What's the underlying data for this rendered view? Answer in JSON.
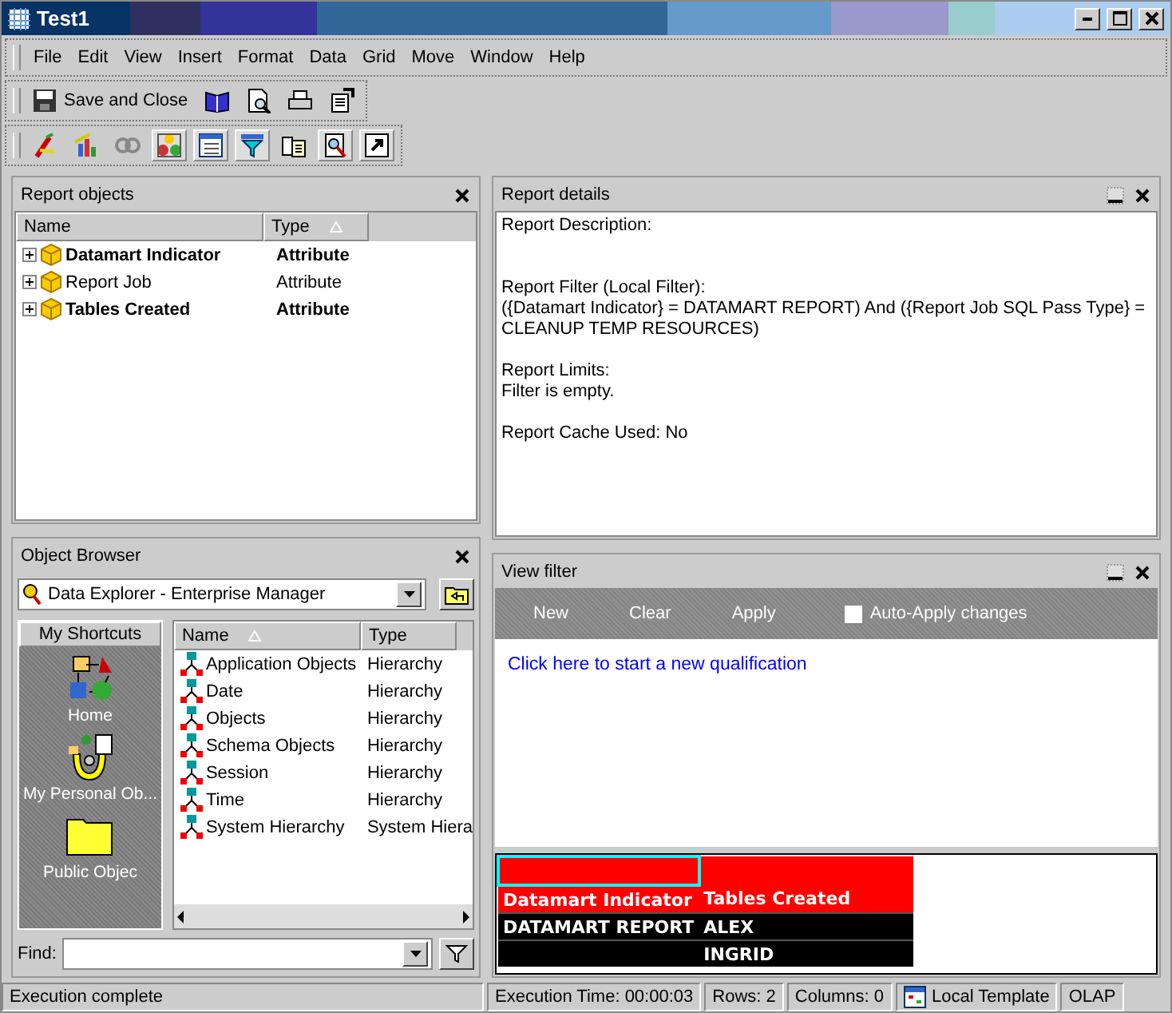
{
  "window": {
    "title": "Test1"
  },
  "menu": [
    "File",
    "Edit",
    "View",
    "Insert",
    "Format",
    "Data",
    "Grid",
    "Move",
    "Window",
    "Help"
  ],
  "toolbar_1": [
    {
      "kind": "save",
      "label": "Save and Close"
    },
    {
      "kind": "book"
    },
    {
      "kind": "preview"
    },
    {
      "kind": "print"
    },
    {
      "kind": "export"
    }
  ],
  "toolbar_2": [
    {
      "kind": "wand",
      "pressed": false
    },
    {
      "kind": "chart-edit",
      "pressed": false
    },
    {
      "kind": "link",
      "pressed": false
    },
    {
      "kind": "objects",
      "pressed": true
    },
    {
      "kind": "grid",
      "pressed": true
    },
    {
      "kind": "filter",
      "pressed": true
    },
    {
      "kind": "book-page",
      "pressed": false
    },
    {
      "kind": "zoom",
      "pressed": true
    },
    {
      "kind": "arrow",
      "pressed": true
    }
  ],
  "report_objects": {
    "title": "Report objects",
    "columns": [
      {
        "label": "Name",
        "sorted": false
      },
      {
        "label": "Type",
        "sorted": true
      }
    ],
    "rows": [
      {
        "name": "Datamart Indicator",
        "type": "Attribute",
        "bold": true
      },
      {
        "name": "Report Job",
        "type": "Attribute",
        "bold": false
      },
      {
        "name": "Tables Created",
        "type": "Attribute",
        "bold": true
      }
    ]
  },
  "object_browser": {
    "title": "Object Browser",
    "source": "Data Explorer - Enterprise Manager",
    "shortcuts_title": "My Shortcuts",
    "shortcuts": [
      {
        "kind": "home",
        "label": "Home"
      },
      {
        "kind": "personal",
        "label": "My Personal Ob..."
      },
      {
        "kind": "folder",
        "label": "Public Objec"
      }
    ],
    "columns": [
      {
        "label": "Name",
        "sorted": true
      },
      {
        "label": "Type",
        "sorted": false
      }
    ],
    "rows": [
      {
        "name": "Application Objects",
        "type": "Hierarchy"
      },
      {
        "name": "Date",
        "type": "Hierarchy"
      },
      {
        "name": "Objects",
        "type": "Hierarchy"
      },
      {
        "name": "Schema Objects",
        "type": "Hierarchy"
      },
      {
        "name": "Session",
        "type": "Hierarchy"
      },
      {
        "name": "Time",
        "type": "Hierarchy"
      },
      {
        "name": "System Hierarchy",
        "type": "System Hiera"
      }
    ],
    "find_label": "Find:"
  },
  "report_details": {
    "title": "Report details",
    "sections": [
      [
        "Report Description:"
      ],
      [
        "Report Filter (Local Filter):",
        "({Datamart Indicator} = DATAMART REPORT) And ({Report Job SQL Pass Type} = CLEANUP TEMP RESOURCES)"
      ],
      [
        "Report Limits:",
        "Filter is empty."
      ],
      [
        "Report Cache Used: No"
      ]
    ]
  },
  "view_filter": {
    "title": "View filter",
    "buttons": [
      "New",
      "Clear",
      "Apply"
    ],
    "auto_apply": {
      "label": "Auto-Apply changes",
      "checked": false
    },
    "link": "Click here to start a new qualification"
  },
  "grid": {
    "columns": [
      "Datamart Indicator",
      "Tables Created"
    ],
    "rows": [
      [
        "DATAMART REPORT",
        "ALEX"
      ],
      [
        "",
        "INGRID"
      ]
    ]
  },
  "status_bar": {
    "message": "Execution complete",
    "execution_time": "Execution Time: 00:00:03",
    "rows": "Rows: 2",
    "columns": "Columns: 0",
    "template": "Local Template",
    "mode": "OLAP"
  }
}
